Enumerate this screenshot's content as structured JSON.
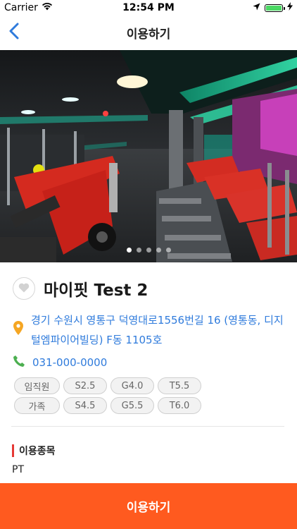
{
  "status_bar": {
    "carrier": "Carrier",
    "time": "12:54 PM",
    "battery_level": 1.0
  },
  "nav": {
    "title": "이용하기",
    "back_icon": "chevron-left-icon"
  },
  "hero": {
    "image": "gym-interior-photo",
    "page_count": 5,
    "active_page": 1
  },
  "place": {
    "name": "마이핏 Test 2",
    "favorite_icon": "heart-icon",
    "address": "경기 수원시 영통구 덕영대로1556번길 16 (영통동, 디지털엠파이어빌딩) F동 1105호",
    "address_icon": "map-pin-icon",
    "phone": "031-000-0000",
    "phone_icon": "phone-icon"
  },
  "chips": [
    [
      "임직원",
      "S2.5",
      "G4.0",
      "T5.5"
    ],
    [
      "가족",
      "S4.5",
      "G5.5",
      "T6.0"
    ]
  ],
  "section": {
    "title": "이용종목",
    "value": "PT"
  },
  "cta": {
    "label": "이용하기"
  },
  "colors": {
    "link": "#2f7bdc",
    "accent": "#ff5a1f",
    "section_bar": "#e53935",
    "pin": "#f5a623",
    "phone": "#4caf50"
  }
}
